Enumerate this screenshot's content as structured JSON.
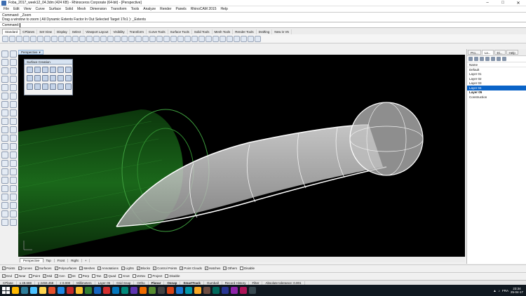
{
  "window": {
    "title": "Foba_2017_week12_04.3dm (424 KB) - Rhinoceros Corporate (64-bit) - [Perspective]"
  },
  "menu": [
    "File",
    "Edit",
    "View",
    "Curve",
    "Surface",
    "Solid",
    "Mesh",
    "Dimension",
    "Transform",
    "Tools",
    "Analyze",
    "Render",
    "Panels",
    "RhinoCAM 2015",
    "Help"
  ],
  "command_history": {
    "line1": "Command: _Zoom",
    "line2": "Drag a window to zoom ( All  Dynamic  Extents  Factor  In  Out  Selected  Target  1To1 ): _Extents"
  },
  "command_prompt": "Command:",
  "toolbar_tabs": [
    "Standard",
    "CPlanes",
    "Set View",
    "Display",
    "Select",
    "Viewport Layout",
    "Visibility",
    "Transform",
    "Curve Tools",
    "Surface Tools",
    "Solid Tools",
    "Mesh Tools",
    "Render Tools",
    "Drafting",
    "New in V5"
  ],
  "viewport": {
    "label": "Perspective",
    "colors": {
      "background": "#000000",
      "cylinder": "#1f7a1f",
      "surface": "#d8d8d8"
    }
  },
  "floating_panel": {
    "title": "Surface Creation"
  },
  "viewport_tabs": [
    "Perspective",
    "Top",
    "Front",
    "Right"
  ],
  "right_panel": {
    "tabs": [
      "Pro...",
      "La...",
      "Di...",
      "Help"
    ],
    "name_header": "Name",
    "layers": [
      "Default",
      "Layer 01",
      "Layer 02",
      "Layer 03",
      "Layer 04",
      "Layer 05",
      "Construction"
    ],
    "selected_layer": "Layer 04"
  },
  "osnap_row1": [
    "Points",
    "Curves",
    "Surfaces",
    "Polysurfaces",
    "Meshes",
    "Annotations",
    "Lights",
    "Blocks",
    "Control Points",
    "Point Clouds",
    "Hatches",
    "Others",
    "Disable"
  ],
  "osnap_row2": [
    "End",
    "Near",
    "Point",
    "Mid",
    "Cen",
    "Int",
    "Perp",
    "Tan",
    "Quad",
    "Knot",
    "Vertex",
    "Project",
    "Disable"
  ],
  "status_bar": {
    "cplane": "CPlane",
    "x": "x 49.688",
    "y": "y 2459.458",
    "z": "z 0.000",
    "units": "Millimeters",
    "layer": "Layer 05",
    "grid_snap": "Grid Snap",
    "ortho": "Ortho",
    "planar": "Planar",
    "osnap": "Osnap",
    "smarttrack": "SmartTrack",
    "gumball": "Gumball",
    "record_history": "Record History",
    "filter": "Filter",
    "tolerance": "Absolute tolerance: 0.001"
  },
  "taskbar": {
    "language": "FRA",
    "time": "23:34",
    "date": "25-04-17",
    "app_colors": [
      "#ffb900",
      "#2d7d9a",
      "#4cc2ff",
      "#ffd54f",
      "#e6512c",
      "#1e88e5",
      "#c62828",
      "#fbc02d",
      "#2e7d32",
      "#1565c0",
      "#d32f2f",
      "#0277bd",
      "#00897b",
      "#5e35b1",
      "#ef6c00",
      "#558b2f",
      "#424242",
      "#d84315",
      "#1976d2",
      "#0097a7",
      "#f9a825",
      "#6d4c41",
      "#00695c",
      "#283593",
      "#8e24aa",
      "#ad1457",
      "#37474f"
    ]
  }
}
